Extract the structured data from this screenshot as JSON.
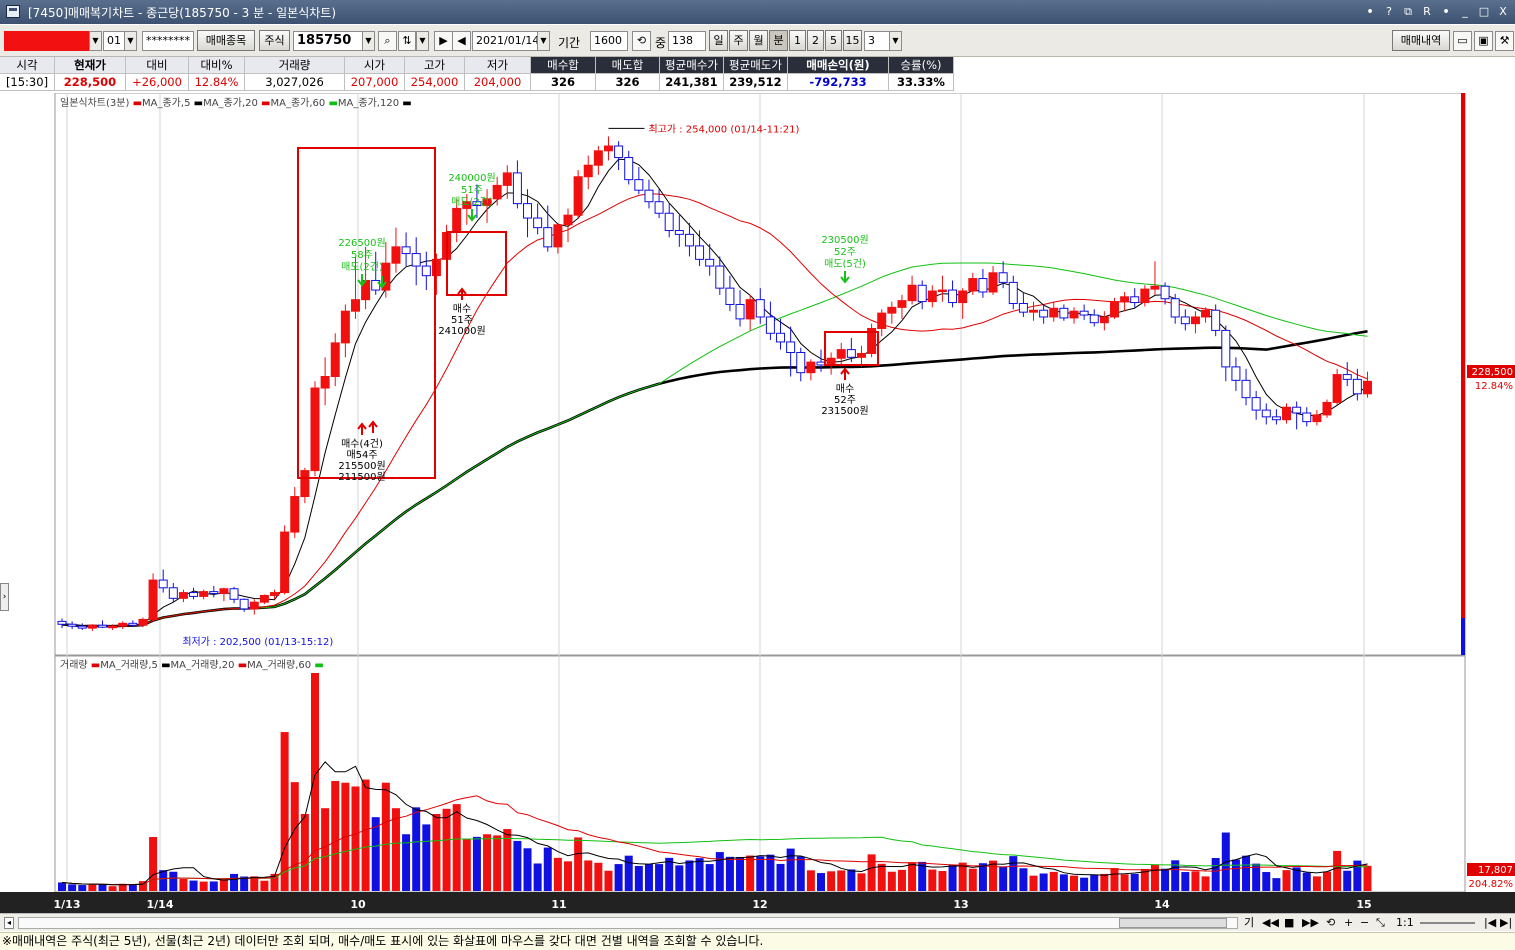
{
  "window": {
    "title": "[7450]매매복기차트 - 종근당(185750 - 3 분 - 일본식차트)",
    "buttons": [
      "ꔷ",
      "?",
      "⧉",
      "R",
      "ꔷ",
      "_",
      "□",
      "X"
    ]
  },
  "toolbar": {
    "account_suffix": "01",
    "password_mask": "********",
    "trade_item_btn": "매매종목",
    "market": "주식",
    "code": "185750",
    "date": "2021/01/14",
    "period_label": "기간",
    "period_value": "1600",
    "count_label": "중",
    "count_value": "138",
    "tf_day": "일",
    "tf_week": "주",
    "tf_month": "월",
    "tf_min": "분",
    "tf_1": "1",
    "tf_2": "2",
    "tf_5": "5",
    "tf_15": "15",
    "tf_sel": "3",
    "trade_history_btn": "매매내역"
  },
  "info": {
    "headers": [
      "시각",
      "현재가",
      "대비",
      "대비%",
      "거래량",
      "시가",
      "고가",
      "저가",
      "매수합",
      "매도합",
      "평균매수가",
      "평균매도가",
      "매매손익(원)",
      "승률(%)"
    ],
    "values": [
      "[15:30]",
      "228,500",
      "+26,000",
      "12.84%",
      "3,027,026",
      "207,000",
      "254,000",
      "204,000",
      "326",
      "326",
      "241,381",
      "239,512",
      "-792,733",
      "33.33%"
    ]
  },
  "legend_price": {
    "chart": "일본식차트(3분)",
    "ma5": "MA_종가,5",
    "ma20": "MA_종가,20",
    "ma60": "MA_종가,60",
    "ma120": "MA_종가,120"
  },
  "legend_volume": {
    "chart": "거래량",
    "ma5": "MA_거래량,5",
    "ma20": "MA_거래량,20",
    "ma60": "MA_거래량,60"
  },
  "annotations": {
    "high": "최고가 : 254,000 (01/14-11:21)",
    "low": "최저가 : 202,500 (01/13-15:12)",
    "price_now": "228,500",
    "price_pct": "12.84%",
    "vol_now": "17,807",
    "vol_pct": "204.82%",
    "sell1_a": "226500원",
    "sell1_b": "58주",
    "sell1_c": "매도(2건)",
    "sell2_a": "240000원",
    "sell2_b": "51주",
    "sell2_c": "매도(2건)",
    "sell3_a": "230500원",
    "sell3_b": "52주",
    "sell3_c": "매도(5건)",
    "buy1_a": "매수(4건)",
    "buy1_b": "매54주",
    "buy1_c": "215500원",
    "buy1_d": "211500원",
    "buy2_a": "매수",
    "buy2_b": "51주",
    "buy2_c": "241000원",
    "buy3_a": "매수",
    "buy3_b": "52주",
    "buy3_c": "231500원"
  },
  "x_labels": [
    "1/13",
    "1/14",
    "10",
    "11",
    "12",
    "13",
    "14",
    "15"
  ],
  "nav": {
    "label": "기",
    "zoom": "1:1"
  },
  "status": "※매매내역은 주식(최근 5년), 선물(최근 2년) 데이터만 조회 되며, 매수/매도 표시에 있는 화살표에 마우스를 갖다 대면 건별 내역을 조회할 수 있습니다.",
  "colors": {
    "up": "#f01010",
    "down": "#1010e0",
    "ma5": "#000000",
    "ma20": "#e00000",
    "ma60": "#10c010",
    "ma120": "#000000",
    "sell_marker": "#18c018",
    "buy_marker": "#e00000"
  },
  "chart_data": {
    "type": "candlestick",
    "title": "일본식차트(3분)",
    "price_range": [
      200000,
      258000
    ],
    "high": 254000,
    "low": 202500,
    "last": 228500,
    "x_ticks": [
      "1/13",
      "1/14",
      "10",
      "11",
      "12",
      "13",
      "14",
      "15"
    ],
    "candles": [
      [
        203500,
        203800,
        202800,
        203200
      ],
      [
        203200,
        203500,
        202700,
        203000
      ],
      [
        203000,
        203300,
        202600,
        202800
      ],
      [
        202800,
        203200,
        202500,
        203100
      ],
      [
        203100,
        203600,
        202800,
        202900
      ],
      [
        202900,
        203200,
        202600,
        203000
      ],
      [
        203000,
        203500,
        202700,
        203300
      ],
      [
        203300,
        203600,
        202900,
        203100
      ],
      [
        203100,
        203900,
        202900,
        203700
      ],
      [
        203700,
        208500,
        203500,
        207800
      ],
      [
        207800,
        208900,
        206500,
        207000
      ],
      [
        207000,
        207500,
        205500,
        205900
      ],
      [
        205900,
        206800,
        205500,
        206500
      ],
      [
        206500,
        207000,
        205800,
        206100
      ],
      [
        206100,
        206800,
        205800,
        206600
      ],
      [
        206600,
        207200,
        206000,
        206400
      ],
      [
        206400,
        207000,
        205600,
        206900
      ],
      [
        206900,
        207100,
        205400,
        205800
      ],
      [
        205800,
        205900,
        204500,
        204800
      ],
      [
        204800,
        205800,
        204200,
        205500
      ],
      [
        205500,
        206300,
        205300,
        206200
      ],
      [
        206200,
        206800,
        205800,
        206500
      ],
      [
        206500,
        213500,
        206300,
        212800
      ],
      [
        212800,
        217500,
        212200,
        216500
      ],
      [
        216500,
        219500,
        215800,
        219200
      ],
      [
        219200,
        228500,
        218600,
        227800
      ],
      [
        227800,
        231000,
        226000,
        229000
      ],
      [
        229000,
        233500,
        228000,
        232500
      ],
      [
        232500,
        236500,
        231000,
        235800
      ],
      [
        235800,
        241500,
        235000,
        237000
      ],
      [
        237000,
        242500,
        236000,
        239000
      ],
      [
        239000,
        242000,
        237500,
        238000
      ],
      [
        238000,
        243000,
        237200,
        240800
      ],
      [
        240800,
        244500,
        239800,
        242500
      ],
      [
        242500,
        244000,
        240500,
        241800
      ],
      [
        241800,
        243500,
        238500,
        240500
      ],
      [
        240500,
        242000,
        238000,
        239500
      ],
      [
        239500,
        241800,
        237500,
        241200
      ],
      [
        241200,
        244800,
        240800,
        244000
      ],
      [
        244000,
        247500,
        243000,
        246500
      ],
      [
        246500,
        248000,
        244800,
        247200
      ],
      [
        247200,
        249000,
        245500,
        246800
      ],
      [
        246800,
        248500,
        245000,
        247500
      ],
      [
        247500,
        249800,
        246800,
        248900
      ],
      [
        248900,
        251000,
        247500,
        250200
      ],
      [
        250200,
        251500,
        246500,
        247000
      ],
      [
        247000,
        248500,
        243500,
        245500
      ],
      [
        245500,
        247000,
        243800,
        244500
      ],
      [
        244500,
        246800,
        242000,
        242500
      ],
      [
        242500,
        245000,
        241800,
        244800
      ],
      [
        244800,
        246500,
        243000,
        245800
      ],
      [
        245800,
        250500,
        245500,
        249800
      ],
      [
        249800,
        252000,
        248500,
        251000
      ],
      [
        251000,
        253000,
        250000,
        252500
      ],
      [
        252500,
        254000,
        251500,
        253000
      ],
      [
        253000,
        253500,
        250500,
        251800
      ],
      [
        251800,
        252500,
        249000,
        249500
      ],
      [
        249500,
        250800,
        248000,
        248400
      ],
      [
        248400,
        249500,
        246500,
        247200
      ],
      [
        247200,
        248500,
        245500,
        246000
      ],
      [
        246000,
        247000,
        243500,
        244200
      ],
      [
        244200,
        245800,
        242500,
        243800
      ],
      [
        243800,
        245000,
        241500,
        242600
      ],
      [
        242600,
        244200,
        240500,
        241200
      ],
      [
        241200,
        242800,
        239500,
        240500
      ],
      [
        240500,
        241500,
        237500,
        238200
      ],
      [
        238200,
        239500,
        235800,
        236500
      ],
      [
        236500,
        238000,
        234200,
        235000
      ],
      [
        235000,
        237500,
        233800,
        237000
      ],
      [
        237000,
        238200,
        234500,
        235200
      ],
      [
        235200,
        236800,
        232800,
        233500
      ],
      [
        233500,
        235000,
        231800,
        232600
      ],
      [
        232600,
        234200,
        229000,
        231500
      ],
      [
        231500,
        232000,
        228500,
        229400
      ],
      [
        229400,
        230800,
        228600,
        230500
      ],
      [
        230500,
        231800,
        229500,
        230200
      ],
      [
        230200,
        231500,
        229200,
        230900
      ],
      [
        230900,
        232500,
        230200,
        231800
      ],
      [
        231800,
        233000,
        230500,
        231000
      ],
      [
        231000,
        232200,
        230000,
        231400
      ],
      [
        231400,
        234500,
        231000,
        234000
      ],
      [
        234000,
        236000,
        233200,
        235600
      ],
      [
        235600,
        236800,
        234500,
        236200
      ],
      [
        236200,
        237500,
        235000,
        236900
      ],
      [
        236900,
        239500,
        236500,
        238500
      ],
      [
        238500,
        239000,
        236000,
        236800
      ],
      [
        236800,
        238500,
        236200,
        237900
      ],
      [
        237900,
        239500,
        236800,
        238000
      ],
      [
        238000,
        239000,
        236200,
        236700
      ],
      [
        236700,
        238200,
        235000,
        237900
      ],
      [
        237900,
        239800,
        237500,
        239200
      ],
      [
        239200,
        240200,
        237200,
        237800
      ],
      [
        237800,
        240500,
        237500,
        239800
      ],
      [
        239800,
        241000,
        238200,
        238800
      ],
      [
        238800,
        239500,
        236000,
        236600
      ],
      [
        236600,
        237800,
        235200,
        235700
      ],
      [
        235700,
        236800,
        234800,
        235900
      ],
      [
        235900,
        236500,
        234500,
        235200
      ],
      [
        235200,
        236800,
        234700,
        236100
      ],
      [
        236100,
        236500,
        234800,
        235100
      ],
      [
        235100,
        236200,
        234500,
        235800
      ],
      [
        235800,
        236500,
        234900,
        235400
      ],
      [
        235400,
        236000,
        234200,
        234600
      ],
      [
        234600,
        235800,
        233800,
        235200
      ],
      [
        235200,
        237200,
        235000,
        236800
      ],
      [
        236800,
        237800,
        235800,
        237300
      ],
      [
        237300,
        238200,
        236200,
        236700
      ],
      [
        236700,
        238500,
        236300,
        238100
      ],
      [
        238100,
        241000,
        237500,
        238400
      ],
      [
        238400,
        238800,
        236500,
        237100
      ],
      [
        237100,
        237600,
        234500,
        235200
      ],
      [
        235200,
        236000,
        233800,
        234500
      ],
      [
        234500,
        235800,
        233500,
        235200
      ],
      [
        235200,
        236200,
        234600,
        235900
      ],
      [
        235900,
        236500,
        233200,
        233800
      ],
      [
        233800,
        234300,
        228500,
        230000
      ],
      [
        230000,
        231000,
        227500,
        228600
      ],
      [
        228600,
        229800,
        226000,
        226800
      ],
      [
        226800,
        227500,
        224500,
        225500
      ],
      [
        225500,
        226200,
        224000,
        224800
      ],
      [
        224800,
        225600,
        224000,
        224500
      ],
      [
        224500,
        226200,
        224100,
        225800
      ],
      [
        225800,
        226400,
        223500,
        225200
      ],
      [
        225200,
        225800,
        223800,
        224300
      ],
      [
        224300,
        225500,
        223900,
        225000
      ],
      [
        225000,
        226600,
        224700,
        226300
      ],
      [
        226300,
        229800,
        226000,
        229200
      ],
      [
        229200,
        230500,
        228000,
        228700
      ],
      [
        228700,
        229800,
        226500,
        227200
      ],
      [
        227200,
        229500,
        226800,
        228500
      ]
    ],
    "buy_markers": [
      {
        "index": 30,
        "price": 215500,
        "label": "매수(4건) 매54주 215500원 211500원"
      },
      {
        "index": 38,
        "price": 241000,
        "label": "매수 51주 241000원"
      },
      {
        "index": 76,
        "price": 231500,
        "label": "매수 52주 231500원"
      }
    ],
    "sell_markers": [
      {
        "index": 28,
        "price": 226500,
        "label": "226500원 58주 매도(2건)"
      },
      {
        "index": 40,
        "price": 240000,
        "label": "240000원 51주 매도(2건)"
      },
      {
        "index": 74,
        "price": 230500,
        "label": "230500원 52주 매도(5건)"
      }
    ],
    "volume": {
      "title": "거래량",
      "ma_series": [
        "MA_거래량,5",
        "MA_거래량,20",
        "MA_거래량,60"
      ],
      "last": 17807,
      "last_pct": "204.82%"
    }
  }
}
